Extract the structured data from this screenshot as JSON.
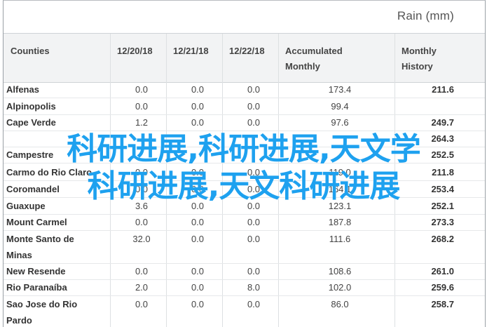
{
  "caption": "Rain (mm)",
  "headers": {
    "counties": "Counties",
    "d1": "12/20/18",
    "d2": "12/21/18",
    "d3": "12/22/18",
    "acc1": "Accumulated",
    "acc2": "Monthly",
    "hist1": "Monthly",
    "hist2": "History"
  },
  "rows": [
    {
      "county": "Alfenas",
      "county2": "",
      "d1": "0.0",
      "d2": "0.0",
      "d3": "0.0",
      "acc": "173.4",
      "hist": "211.6"
    },
    {
      "county": "Alpinopolis",
      "county2": "",
      "d1": "0.0",
      "d2": "0.0",
      "d3": "0.0",
      "acc": "99.4",
      "hist": ""
    },
    {
      "county": "Cape Verde",
      "county2": "",
      "d1": "1.2",
      "d2": "0.0",
      "d3": "0.0",
      "acc": "97.6",
      "hist": "249.7"
    },
    {
      "county": "",
      "county2": "",
      "d1": "",
      "d2": "",
      "d3": "",
      "acc": "",
      "hist": "264.3"
    },
    {
      "county": "Campestre",
      "county2": "",
      "d1": "",
      "d2": "",
      "d3": "",
      "acc": "",
      "hist": "252.5"
    },
    {
      "county": "Carmo do Rio Claro",
      "county2": "",
      "d1": "0.0",
      "d2": "0.0",
      "d3": "0.0",
      "acc": "119.0",
      "hist": "211.8"
    },
    {
      "county": "Coromandel",
      "county2": "",
      "d1": "0.0",
      "d2": "0.0",
      "d3": "0.0",
      "acc": "164.1",
      "hist": "253.4"
    },
    {
      "county": "Guaxupe",
      "county2": "",
      "d1": "3.6",
      "d2": "0.0",
      "d3": "0.0",
      "acc": "123.1",
      "hist": "252.1"
    },
    {
      "county": "Mount Carmel",
      "county2": "",
      "d1": "0.0",
      "d2": "0.0",
      "d3": "0.0",
      "acc": "187.8",
      "hist": "273.3"
    },
    {
      "county": "Monte Santo de",
      "county2": "Minas",
      "d1": "32.0",
      "d2": "0.0",
      "d3": "0.0",
      "acc": "111.6",
      "hist": "268.2"
    },
    {
      "county": "New Resende",
      "county2": "",
      "d1": "0.0",
      "d2": "0.0",
      "d3": "0.0",
      "acc": "108.6",
      "hist": "261.0"
    },
    {
      "county": "Rio Paranaíba",
      "county2": "",
      "d1": "2.0",
      "d2": "0.0",
      "d3": "8.0",
      "acc": "102.0",
      "hist": "259.6"
    },
    {
      "county": "Sao Jose do Rio",
      "county2": "Pardo",
      "d1": "0.0",
      "d2": "0.0",
      "d3": "0.0",
      "acc": "86.0",
      "hist": "258.7"
    }
  ],
  "overlay": {
    "line1": "科研进展,科研进展,天文学",
    "line2": "科研进展,天文科研进展"
  }
}
